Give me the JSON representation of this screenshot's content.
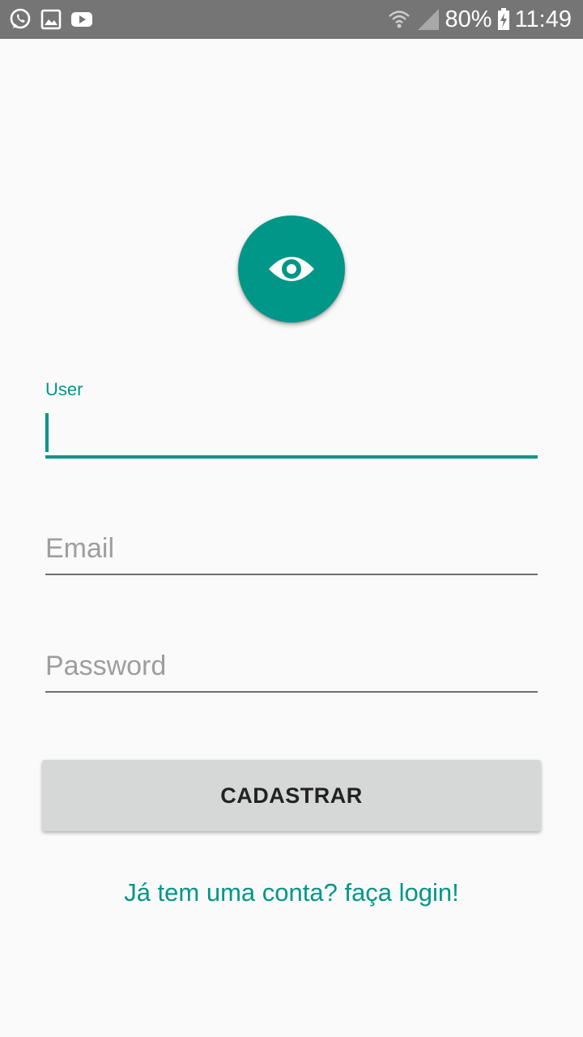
{
  "status_bar": {
    "battery": "80%",
    "time": "11:49",
    "icons": [
      "whatsapp-icon",
      "gallery-icon",
      "youtube-icon",
      "wifi-icon",
      "signal-icon",
      "battery-charging-icon"
    ]
  },
  "logo": {
    "icon": "eye-icon",
    "color": "#009688"
  },
  "form": {
    "user_label": "User",
    "user_value": "",
    "email_placeholder": "Email",
    "password_placeholder": "Password"
  },
  "button": {
    "label": "CADASTRAR"
  },
  "login_link": "Já tem uma conta? faça login!",
  "colors": {
    "accent": "#009688",
    "status_bar": "#757575",
    "button": "#d6d7d7"
  }
}
